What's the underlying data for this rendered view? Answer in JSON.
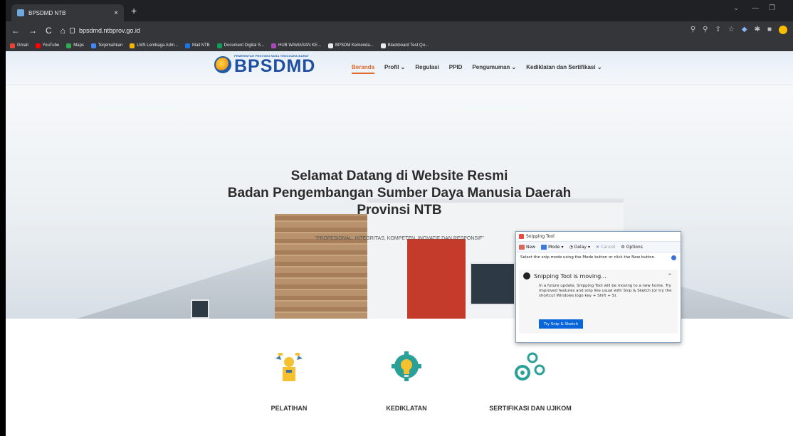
{
  "browser": {
    "tab_title": "BPSDMD NTB",
    "tab_close": "×",
    "new_tab": "+",
    "url": "bpsdmd.ntbprov.go.id",
    "nav_back": "←",
    "nav_forward": "→",
    "nav_reload": "C",
    "nav_home": "⌂",
    "bookmarks": [
      {
        "label": "Gmail",
        "color": "#ea4335"
      },
      {
        "label": "YouTube",
        "color": "#ff0000"
      },
      {
        "label": "Maps",
        "color": "#34a853"
      },
      {
        "label": "Terjemahkan",
        "color": "#4285f4"
      },
      {
        "label": "LMS Lembaga Adm...",
        "color": "#f4b400"
      },
      {
        "label": "Mail NTB",
        "color": "#1a73e8"
      },
      {
        "label": "Document Digital S...",
        "color": "#0f9d58"
      },
      {
        "label": "HUB WAWASAN KE...",
        "color": "#ab47bc"
      },
      {
        "label": "BPSDM Kemenda...",
        "color": "#e8eaed"
      },
      {
        "label": "Blackboard Test Qu...",
        "color": "#e8eaed"
      }
    ]
  },
  "site": {
    "logo_sub": "PEMERINTAH PROVINSI NUSA TENGGARA BARAT",
    "logo_main": "BPSDMD",
    "nav": [
      {
        "label": "Beranda",
        "active": true
      },
      {
        "label": "Profil ⌄"
      },
      {
        "label": "Regulasi"
      },
      {
        "label": "PPID"
      },
      {
        "label": "Pengumuman ⌄"
      },
      {
        "label": "Kediklatan dan Sertifikasi ⌄"
      }
    ],
    "hero": {
      "line1": "Selamat Datang di Website Resmi",
      "line2": "Badan Pengembangan Sumber Daya Manusia Daerah",
      "line3": "Provinsi NTB",
      "tagline": "\"PROFESIONAL, INTEGRITAS, KOMPETEN, INOVATIF DAN RESPONSIF\""
    },
    "features": [
      {
        "label": "PELATIHAN",
        "icon": "trainer-icon"
      },
      {
        "label": "KEDIKLATAN",
        "icon": "lightbulb-gear-icon"
      },
      {
        "label": "SERTIFIKASI DAN UJIKOM",
        "icon": "gears-icon"
      }
    ]
  },
  "snipping_tool": {
    "title": "Snipping Tool",
    "new": "New",
    "mode": "Mode",
    "delay": "Delay",
    "cancel": "Cancel",
    "options": "Options",
    "message": "Select the snip mode using the Mode button or click the New button.",
    "notice_title": "Snipping Tool is moving...",
    "notice_body": "In a future update, Snipping Tool will be moving to a new home. Try improved features and snip like usual with Snip & Sketch (or try the shortcut Windows logo key + Shift + S).",
    "try_button": "Try Snip & Sketch"
  }
}
